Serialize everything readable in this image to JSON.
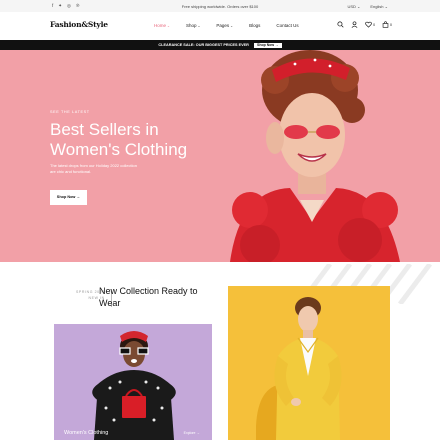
{
  "topbar": {
    "social_icons": [
      "facebook-icon",
      "twitter-icon",
      "instagram-icon",
      "pinterest-icon"
    ],
    "announcement": "Free shipping worldwide. Orders over $100",
    "currency": "USD",
    "language": "English"
  },
  "header": {
    "logo": "Fashion&Style",
    "nav": [
      {
        "label": "Home"
      },
      {
        "label": "Shop"
      },
      {
        "label": "Pages"
      },
      {
        "label": "Blogs"
      },
      {
        "label": "Contact Us"
      }
    ],
    "icons": [
      "search-icon",
      "user-icon",
      "heart-icon",
      "cart-icon"
    ],
    "wishlist_count": "0",
    "cart_count": "0"
  },
  "promo": {
    "text": "CLEARANCE SALE: OUR BIGGEST PRICES EVER",
    "button": "Shop Now"
  },
  "hero": {
    "eyebrow": "SEE THE LATEST",
    "headline": "Best Sellers in Women's Clothing",
    "description": "The latest drops from our Holiday 2022 collection are chic and functional.",
    "button": "Shop Now"
  },
  "collection": {
    "season_line1": "SPRING 2023",
    "season_line2": "NEW IN",
    "title": "New Collection Ready to Wear",
    "card_left_label": "Women's Clothing",
    "card_left_cta": "Explore"
  },
  "colors": {
    "accent": "#e8647a",
    "hero_bg": "#f2a0a7",
    "card_left_bg": "#c4a8d9",
    "card_right_bg": "#f5c03a"
  }
}
